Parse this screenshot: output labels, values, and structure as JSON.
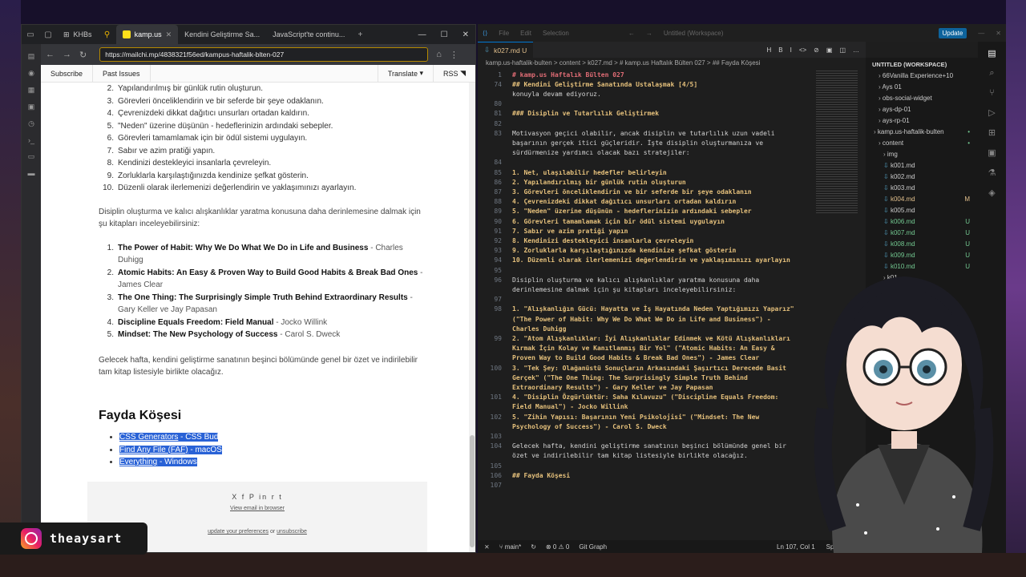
{
  "browser": {
    "tabs": [
      {
        "label": "KHBs"
      },
      {
        "label": "kamp.us",
        "active": true
      },
      {
        "label": "Kendini Geliştirme Sa..."
      },
      {
        "label": "JavaScript'te continu..."
      }
    ],
    "url": "https://mailchi.mp/4838321f56ed/kampus-haftalik-blten-027",
    "mailchimp_nav": {
      "subscribe": "Subscribe",
      "past_issues": "Past Issues",
      "translate": "Translate",
      "rss": "RSS"
    },
    "rules_list": [
      {
        "n": "2.",
        "text": "Yapılandırılmış bir günlük rutin oluşturun."
      },
      {
        "n": "3.",
        "text": "Görevleri önceliklendirin ve bir seferde bir şeye odaklanın."
      },
      {
        "n": "4.",
        "text": "Çevrenizdeki dikkat dağıtıcı unsurları ortadan kaldırın."
      },
      {
        "n": "5.",
        "text": "\"Neden\" üzerine düşünün - hedeflerinizin ardındaki sebepler."
      },
      {
        "n": "6.",
        "text": "Görevleri tamamlamak için bir ödül sistemi uygulayın."
      },
      {
        "n": "7.",
        "text": "Sabır ve azim pratiği yapın."
      },
      {
        "n": "8.",
        "text": "Kendinizi destekleyici insanlarla çevreleyin."
      },
      {
        "n": "9.",
        "text": "Zorluklarla karşılaştığınızda kendinize şefkat gösterin."
      },
      {
        "n": "10.",
        "text": "Düzenli olarak ilerlemenizi değerlendirin ve yaklaşımınızı ayarlayın."
      }
    ],
    "books_intro": "Disiplin oluşturma ve kalıcı alışkanlıklar yaratma konusuna daha derinlemesine dalmak için şu kitapları inceleyebilirsiniz:",
    "books": [
      {
        "n": "1.",
        "title": "The Power of Habit: Why We Do What We Do in Life and Business",
        "author": " - Charles Duhigg"
      },
      {
        "n": "2.",
        "title": "Atomic Habits: An Easy & Proven Way to Build Good Habits & Break Bad Ones",
        "author": " - James Clear"
      },
      {
        "n": "3.",
        "title": "The One Thing: The Surprisingly Simple Truth Behind Extraordinary Results",
        "author": " - Gary Keller ve Jay Papasan"
      },
      {
        "n": "4.",
        "title": "Discipline Equals Freedom: Field Manual",
        "author": " - Jocko Willink"
      },
      {
        "n": "5.",
        "title": "Mindset: The New Psychology of Success",
        "author": " - Carol S. Dweck"
      }
    ],
    "next_week": "Gelecek hafta, kendini geliştirme sanatının beşinci bölümünde genel bir özet ve indirilebilir tam kitap listesiyle birlikte olacağız.",
    "fayda_title": "Fayda Köşesi",
    "links": [
      {
        "link": "CSS Generators",
        "rest": " - CSS Bud"
      },
      {
        "link": "Find Any File (FAF)",
        "rest": " - macOS"
      },
      {
        "link": "Everything",
        "rest": " - Windows"
      }
    ],
    "footer": {
      "view_in_browser": "View email in browser",
      "update_prefs": "update your preferences",
      "or": " or ",
      "unsubscribe": "unsubscribe"
    }
  },
  "vscode": {
    "title": "Untitled (Workspace)",
    "update_label": "Update",
    "tab_label": "k027.md U",
    "breadcrumb": "kamp.us-haftalik-bulten > content > k027.md > # kamp.us Haftalık Bülten 027 > ## Fayda Köşesi",
    "sticky_lines": [
      {
        "ln": "1",
        "text": "# kamp.us Haftalık Bülten 027",
        "cls": "c-head"
      },
      {
        "ln": "74",
        "text": "## Kendini Geliştirme Sanatında Ustalaşmak [4/5]",
        "cls": "c-list"
      }
    ],
    "lines": [
      {
        "ln": "",
        "text": "konuyla devam ediyoruz.",
        "cls": "c-body"
      },
      {
        "ln": "80",
        "text": "",
        "cls": "c-body"
      },
      {
        "ln": "81",
        "text": "### Disiplin ve Tutarlılık Geliştirmek",
        "cls": "c-list"
      },
      {
        "ln": "82",
        "text": "",
        "cls": "c-body"
      },
      {
        "ln": "83",
        "text": "Motivasyon geçici olabilir, ancak disiplin ve tutarlılık uzun vadeli",
        "cls": "c-body"
      },
      {
        "ln": "",
        "text": "başarının gerçek itici güçleridir. İşte disiplin oluşturmanıza ve",
        "cls": "c-body"
      },
      {
        "ln": "",
        "text": "sürdürmenize yardımcı olacak bazı stratejiler:",
        "cls": "c-body"
      },
      {
        "ln": "84",
        "text": "",
        "cls": "c-body"
      },
      {
        "ln": "85",
        "text": "1. Net, ulaşılabilir hedefler belirleyin",
        "cls": "c-list"
      },
      {
        "ln": "86",
        "text": "2. Yapılandırılmış bir günlük rutin oluşturun",
        "cls": "c-list"
      },
      {
        "ln": "87",
        "text": "3. Görevleri önceliklendirin ve bir seferde bir şeye odaklanın",
        "cls": "c-list"
      },
      {
        "ln": "88",
        "text": "4. Çevrenizdeki dikkat dağıtıcı unsurları ortadan kaldırın",
        "cls": "c-list"
      },
      {
        "ln": "89",
        "text": "5. \"Neden\" üzerine düşünün - hedeflerinizin ardındaki sebepler",
        "cls": "c-list"
      },
      {
        "ln": "90",
        "text": "6. Görevleri tamamlamak için bir ödül sistemi uygulayın",
        "cls": "c-list"
      },
      {
        "ln": "91",
        "text": "7. Sabır ve azim pratiği yapın",
        "cls": "c-list"
      },
      {
        "ln": "92",
        "text": "8. Kendinizi destekleyici insanlarla çevreleyin",
        "cls": "c-list"
      },
      {
        "ln": "93",
        "text": "9. Zorluklarla karşılaştığınızda kendinize şefkat gösterin",
        "cls": "c-list"
      },
      {
        "ln": "94",
        "text": "10. Düzenli olarak ilerlemenizi değerlendirin ve yaklaşımınızı ayarlayın",
        "cls": "c-list"
      },
      {
        "ln": "95",
        "text": "",
        "cls": "c-body"
      },
      {
        "ln": "96",
        "text": "Disiplin oluşturma ve kalıcı alışkanlıklar yaratma konusuna daha",
        "cls": "c-body"
      },
      {
        "ln": "",
        "text": "derinlemesine dalmak için şu kitapları inceleyebilirsiniz:",
        "cls": "c-body"
      },
      {
        "ln": "97",
        "text": "",
        "cls": "c-body"
      },
      {
        "ln": "98",
        "text": "1. \"Alışkanlığın Gücü: Hayatta ve İş Hayatında Neden Yaptığımızı Yaparız\"",
        "cls": "c-list"
      },
      {
        "ln": "",
        "text": "(\"The Power of Habit: Why We Do What We Do in Life and Business\") -",
        "cls": "c-list"
      },
      {
        "ln": "",
        "text": "Charles Duhigg",
        "cls": "c-list"
      },
      {
        "ln": "99",
        "text": "2. \"Atom Alışkanlıklar: İyi Alışkanlıklar Edinmek ve Kötü Alışkanlıkları",
        "cls": "c-list"
      },
      {
        "ln": "",
        "text": "Kırmak İçin Kolay ve Kanıtlanmış Bir Yol\" (\"Atomic Habits: An Easy &",
        "cls": "c-list"
      },
      {
        "ln": "",
        "text": "Proven Way to Build Good Habits & Break Bad Ones\") - James Clear",
        "cls": "c-list"
      },
      {
        "ln": "100",
        "text": "3. \"Tek Şey: Olağanüstü Sonuçların Arkasındaki Şaşırtıcı Derecede Basit",
        "cls": "c-list"
      },
      {
        "ln": "",
        "text": "Gerçek\" (\"The One Thing: The Surprisingly Simple Truth Behind",
        "cls": "c-list"
      },
      {
        "ln": "",
        "text": "Extraordinary Results\") - Gary Keller ve Jay Papasan",
        "cls": "c-list"
      },
      {
        "ln": "101",
        "text": "4. \"Disiplin Özgürlüktür: Saha Kılavuzu\" (\"Discipline Equals Freedom:",
        "cls": "c-list"
      },
      {
        "ln": "",
        "text": "Field Manual\") - Jocko Willink",
        "cls": "c-list"
      },
      {
        "ln": "102",
        "text": "5. \"Zihin Yapısı: Başarının Yeni Psikolojisi\" (\"Mindset: The New",
        "cls": "c-list"
      },
      {
        "ln": "",
        "text": "Psychology of Success\") - Carol S. Dweck",
        "cls": "c-list"
      },
      {
        "ln": "103",
        "text": "",
        "cls": "c-body"
      },
      {
        "ln": "104",
        "text": "Gelecek hafta, kendini geliştirme sanatının beşinci bölümünde genel bir",
        "cls": "c-body"
      },
      {
        "ln": "",
        "text": "özet ve indirilebilir tam kitap listesiyle birlikte olacağız.",
        "cls": "c-body"
      },
      {
        "ln": "105",
        "text": "",
        "cls": "c-body"
      },
      {
        "ln": "106",
        "text": "## Fayda Köşesi",
        "cls": "c-list"
      },
      {
        "ln": "107",
        "text": "",
        "cls": "c-body"
      }
    ],
    "explorer": {
      "header": "UNTITLED (WORKSPACE)",
      "items": [
        {
          "label": "66Vanilla Experience+10",
          "indent": 1,
          "badge": ""
        },
        {
          "label": "Ays 01",
          "indent": 1,
          "badge": ""
        },
        {
          "label": "obs-social-widget",
          "indent": 1,
          "badge": ""
        },
        {
          "label": "ays-dp-01",
          "indent": 1,
          "badge": ""
        },
        {
          "label": "ays-rp-01",
          "indent": 1,
          "badge": ""
        },
        {
          "label": "kamp.us-haftalik-bulten",
          "indent": 0,
          "badge": "•"
        },
        {
          "label": "content",
          "indent": 1,
          "badge": "•"
        },
        {
          "label": "img",
          "indent": 2,
          "badge": ""
        },
        {
          "label": "k001.md",
          "indent": 2,
          "badge": ""
        },
        {
          "label": "k002.md",
          "indent": 2,
          "badge": ""
        },
        {
          "label": "k003.md",
          "indent": 2,
          "badge": ""
        },
        {
          "label": "k004.md",
          "indent": 2,
          "badge": "M"
        },
        {
          "label": "k005.md",
          "indent": 2,
          "badge": ""
        },
        {
          "label": "k006.md",
          "indent": 2,
          "badge": "U"
        },
        {
          "label": "k007.md",
          "indent": 2,
          "badge": "U"
        },
        {
          "label": "k008.md",
          "indent": 2,
          "badge": "U"
        },
        {
          "label": "k009.md",
          "indent": 2,
          "badge": "U"
        },
        {
          "label": "k010.md",
          "indent": 2,
          "badge": "U"
        },
        {
          "label": "k01",
          "indent": 2,
          "badge": ""
        }
      ]
    },
    "status": {
      "branch": "main*",
      "problems": "0",
      "warnings": "0",
      "git_graph": "Git Graph",
      "position": "Ln 107, Col 1",
      "spaces": "Spaces: 2",
      "encoding": "U"
    }
  },
  "overlay": {
    "instagram_handle": "theaysart"
  }
}
